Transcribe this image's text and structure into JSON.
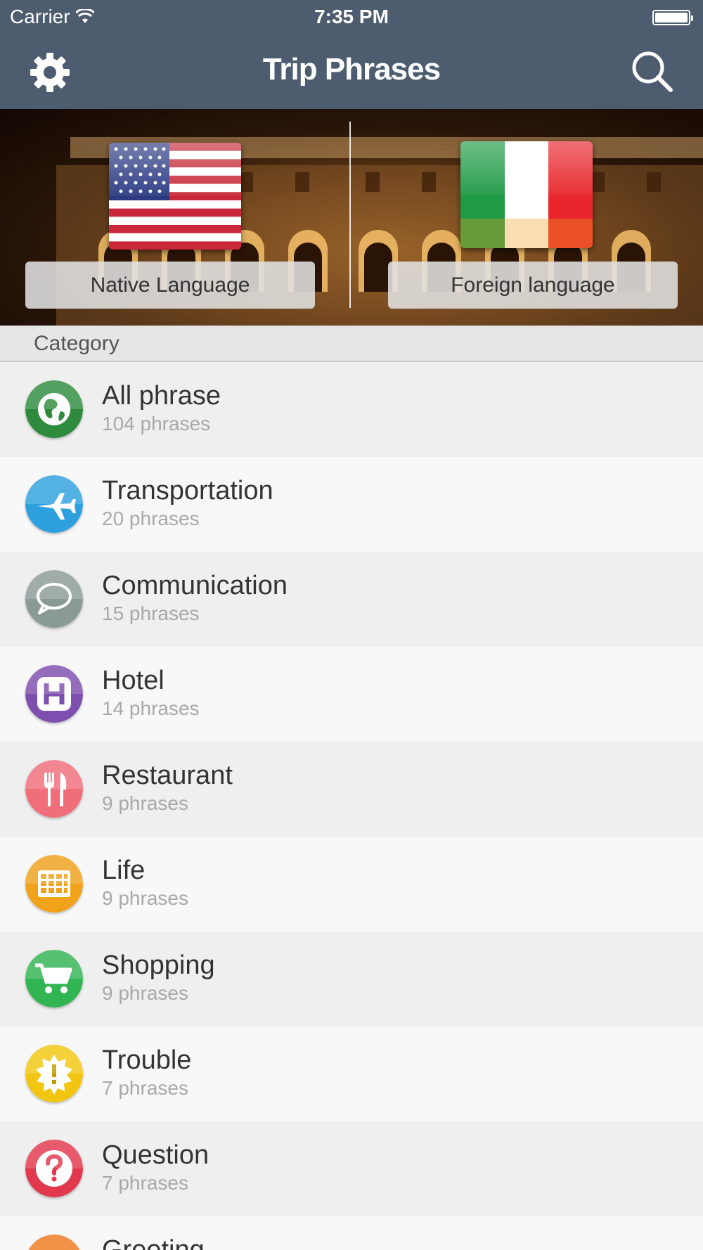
{
  "status_bar": {
    "carrier": "Carrier",
    "time": "7:35 PM"
  },
  "nav": {
    "title": "Trip Phrases",
    "left_icon": "gear-icon",
    "right_icon": "search-icon"
  },
  "languages": {
    "native_label": "Native Language",
    "foreign_label": "Foreign language",
    "native_flag": "us-flag",
    "foreign_flag": "italy-flag"
  },
  "section": {
    "title": "Category"
  },
  "categories": [
    {
      "name": "All phrase",
      "count": "104 phrases",
      "icon": "globe-icon",
      "color": "#2e8b3e"
    },
    {
      "name": "Transportation",
      "count": "20 phrases",
      "icon": "airplane-icon",
      "color": "#2fa0de"
    },
    {
      "name": "Communication",
      "count": "15 phrases",
      "icon": "speech-bubble-icon",
      "color": "#8a9a96"
    },
    {
      "name": "Hotel",
      "count": "14 phrases",
      "icon": "hotel-icon",
      "color": "#7d4fae"
    },
    {
      "name": "Restaurant",
      "count": "9 phrases",
      "icon": "fork-knife-icon",
      "color": "#f06d7a"
    },
    {
      "name": "Life",
      "count": "9 phrases",
      "icon": "calendar-grid-icon",
      "color": "#f0a21a"
    },
    {
      "name": "Shopping",
      "count": "9 phrases",
      "icon": "cart-icon",
      "color": "#31b552"
    },
    {
      "name": "Trouble",
      "count": "7 phrases",
      "icon": "alert-badge-icon",
      "color": "#f2c610"
    },
    {
      "name": "Question",
      "count": "7 phrases",
      "icon": "question-icon",
      "color": "#e2384e"
    },
    {
      "name": "Greeting",
      "count": "",
      "icon": "greeting-icon",
      "color": "#ef7a22"
    }
  ]
}
